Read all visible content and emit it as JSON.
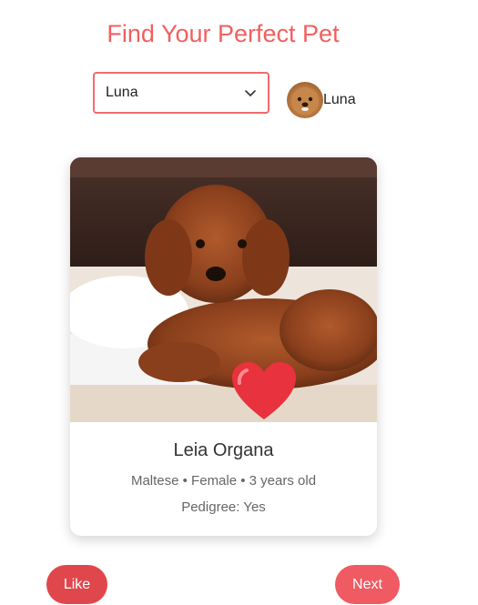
{
  "header": {
    "title": "Find Your Perfect Pet"
  },
  "selector": {
    "selected": "Luna"
  },
  "profile": {
    "name": "Luna"
  },
  "card": {
    "name": "Leia Organa",
    "meta": "Maltese • Female • 3 years old",
    "pedigree": "Pedigree: Yes"
  },
  "actions": {
    "like_label": "Like",
    "next_label": "Next"
  },
  "colors": {
    "accent": "#f0605f",
    "button": "#e0474c",
    "heart": "#e8323e"
  }
}
